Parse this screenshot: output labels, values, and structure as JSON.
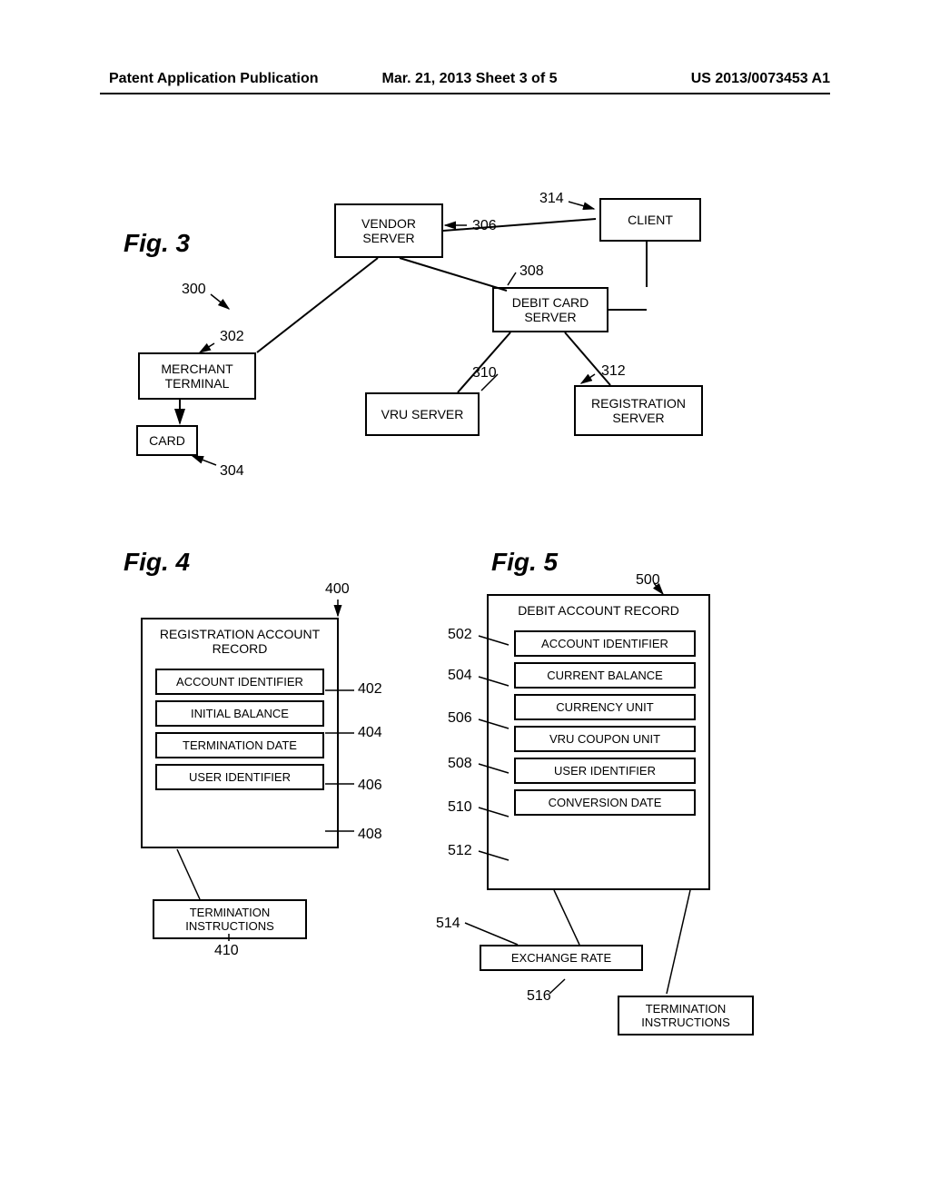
{
  "header": {
    "left": "Patent Application Publication",
    "mid": "Mar. 21, 2013  Sheet 3 of 5",
    "right": "US 2013/0073453 A1"
  },
  "fig3": {
    "title": "Fig. 3",
    "vendor_server": "VENDOR\nSERVER",
    "client": "CLIENT",
    "debit_card_server": "DEBIT CARD\nSERVER",
    "merchant_terminal": "MERCHANT\nTERMINAL",
    "vru_server": "VRU SERVER",
    "registration_server": "REGISTRATION\nSERVER",
    "card": "CARD",
    "refs": {
      "r300": "300",
      "r302": "302",
      "r304": "304",
      "r306": "306",
      "r308": "308",
      "r310": "310",
      "r312": "312",
      "r314": "314"
    }
  },
  "fig4": {
    "title": "Fig. 4",
    "record_title": "REGISTRATION ACCOUNT\nRECORD",
    "fields": {
      "f402": "ACCOUNT IDENTIFIER",
      "f404": "INITIAL BALANCE",
      "f406": "TERMINATION DATE",
      "f408": "USER IDENTIFIER"
    },
    "termination": "TERMINATION\nINSTRUCTIONS",
    "refs": {
      "r400": "400",
      "r402": "402",
      "r404": "404",
      "r406": "406",
      "r408": "408",
      "r410": "410"
    }
  },
  "fig5": {
    "title": "Fig. 5",
    "record_title": "DEBIT ACCOUNT RECORD",
    "fields": {
      "f502": "ACCOUNT IDENTIFIER",
      "f504": "CURRENT BALANCE",
      "f506": "CURRENCY UNIT",
      "f508": "VRU COUPON UNIT",
      "f510": "USER IDENTIFIER",
      "f512": "CONVERSION DATE"
    },
    "exchange_rate": "EXCHANGE RATE",
    "termination": "TERMINATION\nINSTRUCTIONS",
    "refs": {
      "r500": "500",
      "r502": "502",
      "r504": "504",
      "r506": "506",
      "r508": "508",
      "r510": "510",
      "r512": "512",
      "r514": "514",
      "r516": "516"
    }
  }
}
